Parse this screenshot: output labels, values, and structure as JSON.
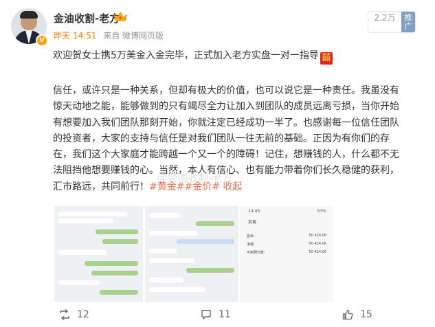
{
  "post": {
    "username": "金油收割-老方",
    "time": "昨天 14:51",
    "source": "来自 微博网页版",
    "read_count": "2.2万",
    "promote_label": "推广",
    "headline": "欢迎贺女士携5万美金入金完毕，正式加入老方实盘一对一指导",
    "headline_emoji": "囍",
    "body_lines": [
      "信任，或许只是一种关系，但却有极大的价值，也可以说它是一种责任。我虽没有",
      "惊天动地之能，能够做到的只有竭尽全力让加入到团队的成员远离亏损，当你开始",
      "有想要加入我们团队那刻开始，你就注定已经成功一半了。也感谢每一位信任团队",
      "的投资者，大家的支持与信任是对我们团队一往无前的基础。正因为有你们的存",
      "在，我们这个大家庭才能跨越一个又一个的障碍！记住，想赚钱的人，什么都不无",
      "法阻挡他想要赚钱的心。当然，本人有信心、也有能力带着你们长久稳健的获利，"
    ],
    "last_line_text": "汇市路远，共同前行！",
    "tags": [
      "#黄金#",
      "#金价#"
    ],
    "collapse_label": "收起",
    "watermark": "@金油收割-老方"
  },
  "images": {
    "trade": {
      "time": "14:45",
      "battery": "53%",
      "title": "交易",
      "rows": [
        {
          "label": "盈余:",
          "value": "50 424.06"
        },
        {
          "label": "净值:",
          "value": "50 424.06"
        },
        {
          "label": "可用预付款:",
          "value": "50 424.06"
        }
      ]
    }
  },
  "footer": {
    "reposts": "12",
    "comments": "11",
    "likes": "15"
  }
}
